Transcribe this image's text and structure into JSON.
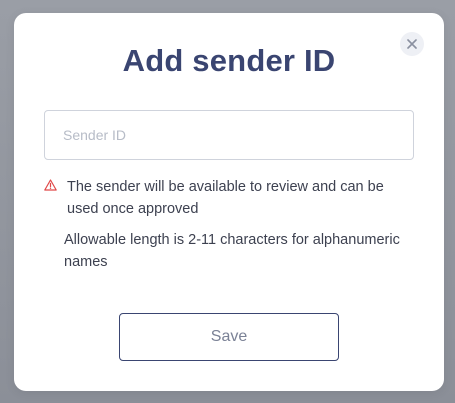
{
  "modal": {
    "title": "Add sender ID",
    "close_icon": "close-icon",
    "sender_input": {
      "value": "",
      "placeholder": "Sender ID"
    },
    "warning": {
      "icon": "warning-triangle-icon",
      "icon_color": "#e04848",
      "text": "The sender will be available to review and can be used once approved"
    },
    "length_note": "Allowable length is 2-11 characters for alphanumeric names",
    "save_label": "Save"
  },
  "colors": {
    "title": "#3a4571",
    "backdrop": "#8e929b",
    "button_border": "#3a4571"
  }
}
